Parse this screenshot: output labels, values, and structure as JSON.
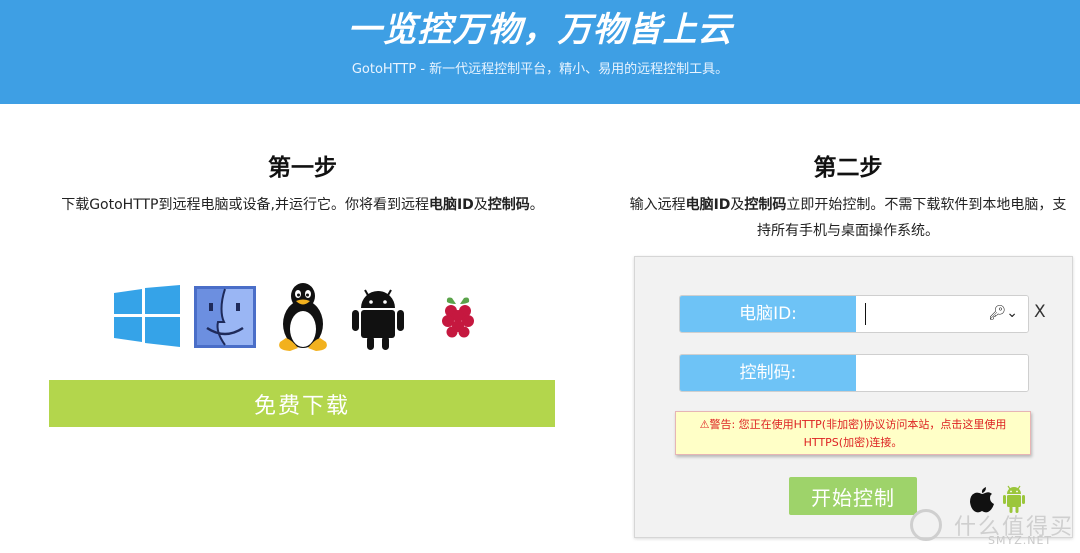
{
  "hero": {
    "title": "一览控万物，万物皆上云",
    "subtitle": "GotoHTTP - 新一代远程控制平台，精小、易用的远程控制工具。",
    "background": "#3e9fe4"
  },
  "step1": {
    "title": "第一步",
    "desc_prefix": "下载GotoHTTP到远程电脑或设备,并运行它。你将看到远程",
    "desc_bold1": "电脑ID",
    "desc_mid": "及",
    "desc_bold2": "控制码",
    "desc_suffix": "。",
    "os_icons": [
      "windows-icon",
      "finder-icon",
      "linux-tux-icon",
      "android-icon",
      "raspberry-pi-icon"
    ],
    "download_label": "免费下载"
  },
  "step2": {
    "title": "第二步",
    "desc_prefix": "输入远程",
    "desc_bold1": "电脑ID",
    "desc_mid": "及",
    "desc_bold2": "控制码",
    "desc_suffix": "立即开始控制。不需下载软件到本地电脑，支持所有手机与桌面操作系统。"
  },
  "panel": {
    "computer_id_label": "电脑ID:",
    "computer_id_value": "",
    "control_code_label": "控制码:",
    "control_code_value": "",
    "clear_label": "X",
    "warning": "⚠警告: 您正在使用HTTP(非加密)协议访问本站，点击这里使用HTTPS(加密)连接。",
    "start_label": "开始控制",
    "platform_icons": [
      "apple-icon",
      "android-icon"
    ]
  },
  "watermark": {
    "text": "什么值得买",
    "sub": "SMYZ.NET"
  },
  "colors": {
    "download_button": "#b3d64c",
    "start_button": "#9ed36a",
    "field_label": "#6ec3f6",
    "warning_bg": "#ffffc7",
    "warning_text": "#dd2222"
  }
}
